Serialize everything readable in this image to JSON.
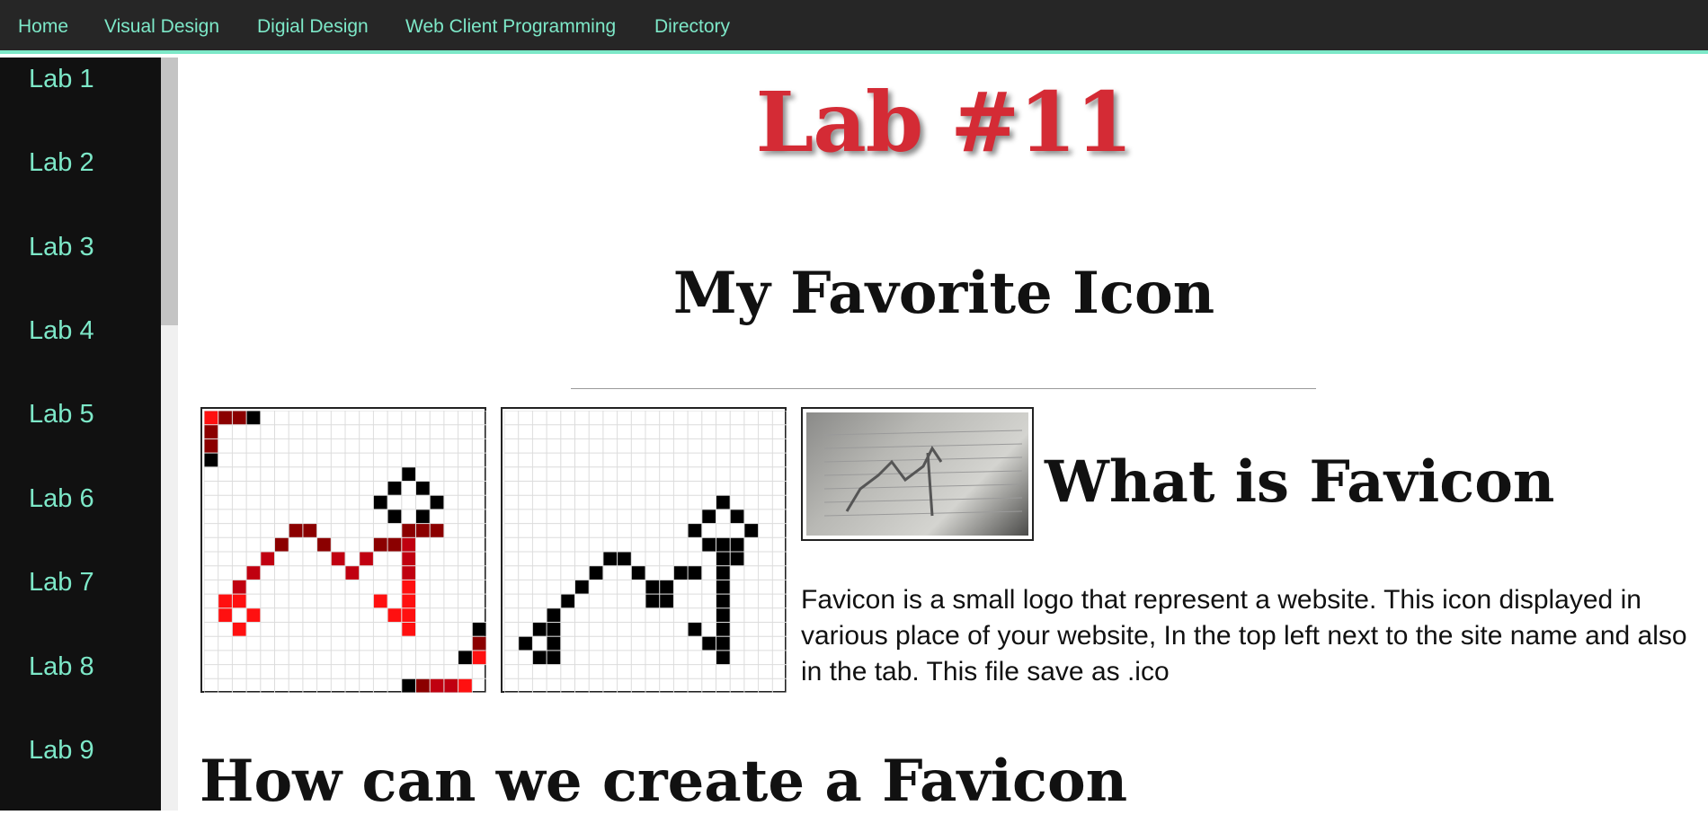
{
  "nav": {
    "items": [
      "Home",
      "Visual Design",
      "Digial Design",
      "Web Client Programming",
      "Directory"
    ]
  },
  "sidebar": {
    "items": [
      "Lab 1",
      "Lab 2",
      "Lab 3",
      "Lab 4",
      "Lab 5",
      "Lab 6",
      "Lab 7",
      "Lab 8",
      "Lab 9"
    ]
  },
  "page": {
    "title": "Lab #11",
    "subtitle": "My Favorite Icon",
    "favicon_heading": "What is Favicon",
    "favicon_paragraph": "Favicon is a small logo that represent a website. This icon displayed in various place of your website, In the top left next to the site name and also in the tab. This file save as .ico",
    "create_heading": "How can we create a Favicon"
  },
  "colors": {
    "accent": "#7de8c8",
    "title_red": "#d42b35",
    "nav_bg": "#262626",
    "sidebar_bg": "#111111"
  }
}
